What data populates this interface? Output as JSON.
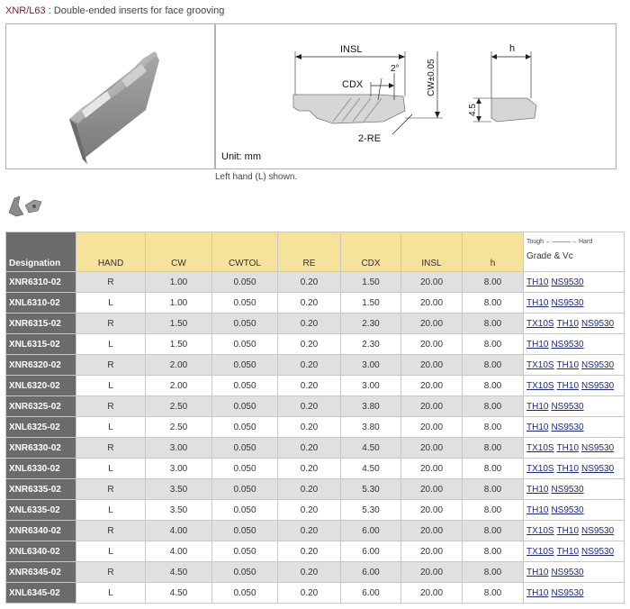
{
  "header": {
    "code": "XNR/L63",
    "separator": " : ",
    "description": "Double-ended inserts for face grooving"
  },
  "drawing": {
    "unit_label": "Unit: mm",
    "insl_label": "INSL",
    "cdx_label": "CDX",
    "angle_label": "2°",
    "cw_label": "CW±0.05",
    "re_label": "2-RE",
    "h_label": "h",
    "dim_label": "4.5"
  },
  "caption": "Left hand (L) shown.",
  "table": {
    "columns": [
      "Designation",
      "HAND",
      "CW",
      "CWTOL",
      "RE",
      "CDX",
      "INSL",
      "h"
    ],
    "grade_header": {
      "tough": "Tough",
      "hard": "Hard",
      "label": "Grade & Vc"
    },
    "rows": [
      {
        "designation": "XNR6310-02",
        "hand": "R",
        "cw": "1.00",
        "cwtol": "0.050",
        "re": "0.20",
        "cdx": "1.50",
        "insl": "20.00",
        "h": "8.00",
        "grades": [
          "TH10",
          "NS9530"
        ]
      },
      {
        "designation": "XNL6310-02",
        "hand": "L",
        "cw": "1.00",
        "cwtol": "0.050",
        "re": "0.20",
        "cdx": "1.50",
        "insl": "20.00",
        "h": "8.00",
        "grades": [
          "TH10",
          "NS9530"
        ]
      },
      {
        "designation": "XNR6315-02",
        "hand": "R",
        "cw": "1.50",
        "cwtol": "0.050",
        "re": "0.20",
        "cdx": "2.30",
        "insl": "20.00",
        "h": "8.00",
        "grades": [
          "TX10S",
          "TH10",
          "NS9530"
        ]
      },
      {
        "designation": "XNL6315-02",
        "hand": "L",
        "cw": "1.50",
        "cwtol": "0.050",
        "re": "0.20",
        "cdx": "2.30",
        "insl": "20.00",
        "h": "8.00",
        "grades": [
          "TH10",
          "NS9530"
        ]
      },
      {
        "designation": "XNR6320-02",
        "hand": "R",
        "cw": "2.00",
        "cwtol": "0.050",
        "re": "0.20",
        "cdx": "3.00",
        "insl": "20.00",
        "h": "8.00",
        "grades": [
          "TX10S",
          "TH10",
          "NS9530"
        ]
      },
      {
        "designation": "XNL6320-02",
        "hand": "L",
        "cw": "2.00",
        "cwtol": "0.050",
        "re": "0.20",
        "cdx": "3.00",
        "insl": "20.00",
        "h": "8.00",
        "grades": [
          "TX10S",
          "TH10",
          "NS9530"
        ]
      },
      {
        "designation": "XNR6325-02",
        "hand": "R",
        "cw": "2.50",
        "cwtol": "0.050",
        "re": "0.20",
        "cdx": "3.80",
        "insl": "20.00",
        "h": "8.00",
        "grades": [
          "TH10",
          "NS9530"
        ]
      },
      {
        "designation": "XNL6325-02",
        "hand": "L",
        "cw": "2.50",
        "cwtol": "0.050",
        "re": "0.20",
        "cdx": "3.80",
        "insl": "20.00",
        "h": "8.00",
        "grades": [
          "TH10",
          "NS9530"
        ]
      },
      {
        "designation": "XNR6330-02",
        "hand": "R",
        "cw": "3.00",
        "cwtol": "0.050",
        "re": "0.20",
        "cdx": "4.50",
        "insl": "20.00",
        "h": "8.00",
        "grades": [
          "TX10S",
          "TH10",
          "NS9530"
        ]
      },
      {
        "designation": "XNL6330-02",
        "hand": "L",
        "cw": "3.00",
        "cwtol": "0.050",
        "re": "0.20",
        "cdx": "4.50",
        "insl": "20.00",
        "h": "8.00",
        "grades": [
          "TX10S",
          "TH10",
          "NS9530"
        ]
      },
      {
        "designation": "XNR6335-02",
        "hand": "R",
        "cw": "3.50",
        "cwtol": "0.050",
        "re": "0.20",
        "cdx": "5.30",
        "insl": "20.00",
        "h": "8.00",
        "grades": [
          "TH10",
          "NS9530"
        ]
      },
      {
        "designation": "XNL6335-02",
        "hand": "L",
        "cw": "3.50",
        "cwtol": "0.050",
        "re": "0.20",
        "cdx": "5.30",
        "insl": "20.00",
        "h": "8.00",
        "grades": [
          "TH10",
          "NS9530"
        ]
      },
      {
        "designation": "XNR6340-02",
        "hand": "R",
        "cw": "4.00",
        "cwtol": "0.050",
        "re": "0.20",
        "cdx": "6.00",
        "insl": "20.00",
        "h": "8.00",
        "grades": [
          "TX10S",
          "TH10",
          "NS9530"
        ]
      },
      {
        "designation": "XNL6340-02",
        "hand": "L",
        "cw": "4.00",
        "cwtol": "0.050",
        "re": "0.20",
        "cdx": "6.00",
        "insl": "20.00",
        "h": "8.00",
        "grades": [
          "TX10S",
          "TH10",
          "NS9530"
        ]
      },
      {
        "designation": "XNR6345-02",
        "hand": "R",
        "cw": "4.50",
        "cwtol": "0.050",
        "re": "0.20",
        "cdx": "6.00",
        "insl": "20.00",
        "h": "8.00",
        "grades": [
          "TH10",
          "NS9530"
        ]
      },
      {
        "designation": "XNL6345-02",
        "hand": "L",
        "cw": "4.50",
        "cwtol": "0.050",
        "re": "0.20",
        "cdx": "6.00",
        "insl": "20.00",
        "h": "8.00",
        "grades": [
          "TH10",
          "NS9530"
        ]
      }
    ]
  }
}
